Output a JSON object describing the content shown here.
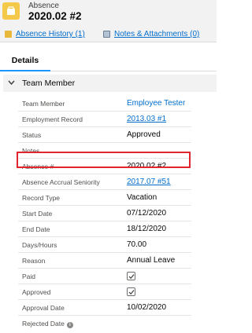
{
  "header": {
    "object_label": "Absence",
    "record_title": "2020.02 #2"
  },
  "related_links": {
    "history_label": "Absence History (1)",
    "notes_label": "Notes & Attachments (0)"
  },
  "tabs": {
    "details_label": "Details"
  },
  "section": {
    "title": "Team Member"
  },
  "fields": [
    {
      "label": "Team Member",
      "value": "Employee Tester",
      "is_link": true
    },
    {
      "label": "Employment Record",
      "value": "2013.03 #1",
      "is_link": true
    },
    {
      "label": "Status",
      "value": "Approved"
    },
    {
      "label": "Notes",
      "value": ""
    },
    {
      "label": "Absence #",
      "value": "2020.02 #2"
    },
    {
      "label": "Absence Accrual Seniority",
      "value": "2017.07 #51",
      "is_link": true
    },
    {
      "label": "Record Type",
      "value": "Vacation"
    },
    {
      "label": "Start Date",
      "value": "07/12/2020"
    },
    {
      "label": "End Date",
      "value": "18/12/2020"
    },
    {
      "label": "Days/Hours",
      "value": "70.00"
    },
    {
      "label": "Reason",
      "value": "Annual Leave"
    },
    {
      "label": "Paid",
      "checked": true
    },
    {
      "label": "Approved",
      "checked": true
    },
    {
      "label": "Approval Date",
      "value": "10/02/2020"
    },
    {
      "label": "Rejected Date",
      "value": "",
      "info_icon": true
    }
  ],
  "colors": {
    "link": "#006dcc",
    "highlight": "#e0252f",
    "header_bg": "#f3f2f2",
    "icon_yellow": "#f4c949"
  }
}
